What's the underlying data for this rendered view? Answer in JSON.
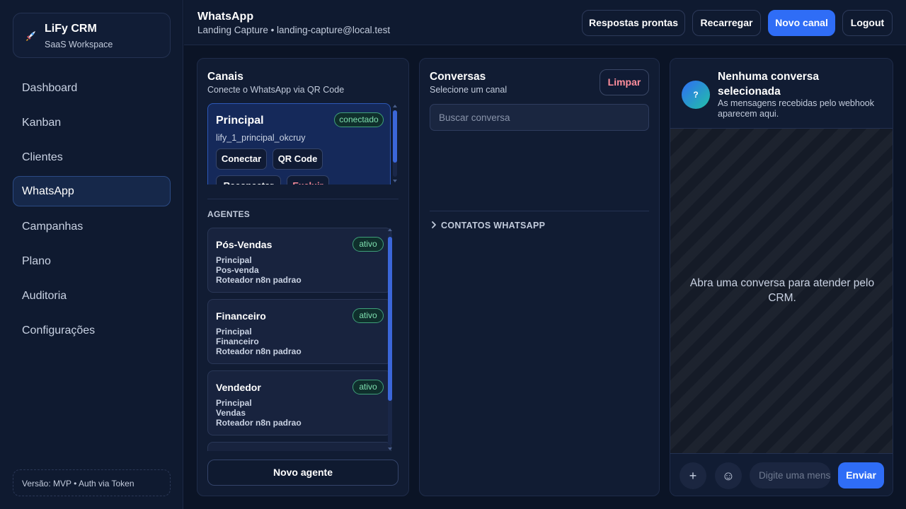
{
  "sidebar": {
    "brand_title": "LiFy CRM",
    "brand_subtitle": "SaaS Workspace",
    "brand_icon": "rocket-icon",
    "items": [
      {
        "label": "Dashboard"
      },
      {
        "label": "Kanban"
      },
      {
        "label": "Clientes"
      },
      {
        "label": "WhatsApp",
        "active": true
      },
      {
        "label": "Campanhas"
      },
      {
        "label": "Plano"
      },
      {
        "label": "Auditoria"
      },
      {
        "label": "Configurações"
      }
    ],
    "version": "Versão: MVP • Auth via Token"
  },
  "header": {
    "title": "WhatsApp",
    "subtitle": "Landing Capture • landing-capture@local.test",
    "buttons": {
      "quick_replies": "Respostas prontas",
      "reload": "Recarregar",
      "new_channel": "Novo canal",
      "logout": "Logout"
    }
  },
  "channels": {
    "title": "Canais",
    "subtitle": "Conecte o WhatsApp via QR Code",
    "items": [
      {
        "name": "Principal",
        "status": "conectado",
        "id": "lify_1_principal_okcruy",
        "actions": {
          "connect": "Conectar",
          "qr": "QR Code",
          "reconnect": "Reconectar",
          "delete": "Excluir"
        }
      }
    ]
  },
  "agents": {
    "label": "AGENTES",
    "items": [
      {
        "name": "Pós-Vendas",
        "status": "ativo",
        "lines": [
          "Principal",
          "Pos-venda",
          "Roteador n8n padrao"
        ]
      },
      {
        "name": "Financeiro",
        "status": "ativo",
        "lines": [
          "Principal",
          "Financeiro",
          "Roteador n8n padrao"
        ]
      },
      {
        "name": "Vendedor",
        "status": "ativo",
        "lines": [
          "Principal",
          "Vendas",
          "Roteador n8n padrao"
        ]
      }
    ],
    "new_agent": "Novo agente"
  },
  "conversations": {
    "title": "Conversas",
    "subtitle": "Selecione um canal",
    "clear": "Limpar",
    "search_placeholder": "Buscar conversa",
    "contacts_label": "CONTATOS WHATSAPP"
  },
  "chat": {
    "avatar": "?",
    "title": "Nenhuma conversa selecionada",
    "subtitle": "As mensagens recebidas pelo webhook aparecem aqui.",
    "empty": "Abra uma conversa para atender pelo CRM.",
    "attach": "+",
    "emoji": "☺",
    "input_placeholder": "Digite uma mensagem",
    "send": "Enviar"
  },
  "colors": {
    "accent": "#2f6df6",
    "success": "#7fe0b0",
    "danger": "#ff8e9c",
    "background": "#0b1426"
  }
}
